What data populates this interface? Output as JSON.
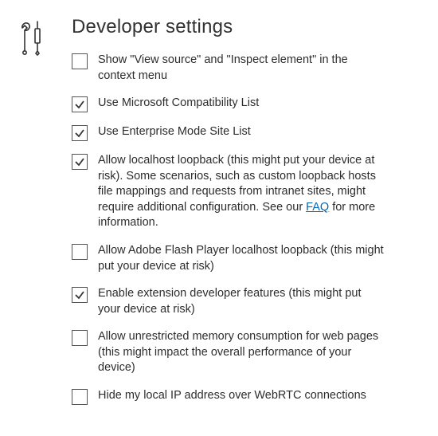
{
  "header": {
    "title": "Developer settings"
  },
  "options": [
    {
      "checked": false,
      "label": "Show \"View source\" and \"Inspect element\" in the context menu"
    },
    {
      "checked": true,
      "label": "Use Microsoft Compatibility List"
    },
    {
      "checked": true,
      "label": "Use Enterprise Mode Site List"
    },
    {
      "checked": true,
      "label_before": "Allow localhost loopback (this might put your device at risk). Some scenarios, such as custom loopback hosts file mappings and requests from intranet sites, might require additional configuration. See our ",
      "link_text": "FAQ",
      "label_after": " for more information."
    },
    {
      "checked": false,
      "label": "Allow Adobe Flash Player localhost loopback (this might put your device at risk)"
    },
    {
      "checked": true,
      "label": "Enable extension developer features (this might put your device at risk)"
    },
    {
      "checked": false,
      "label": "Allow unrestricted memory consumption for web pages (this might impact the overall performance of your device)"
    },
    {
      "checked": false,
      "label": "Hide my local IP address over WebRTC connections"
    }
  ]
}
